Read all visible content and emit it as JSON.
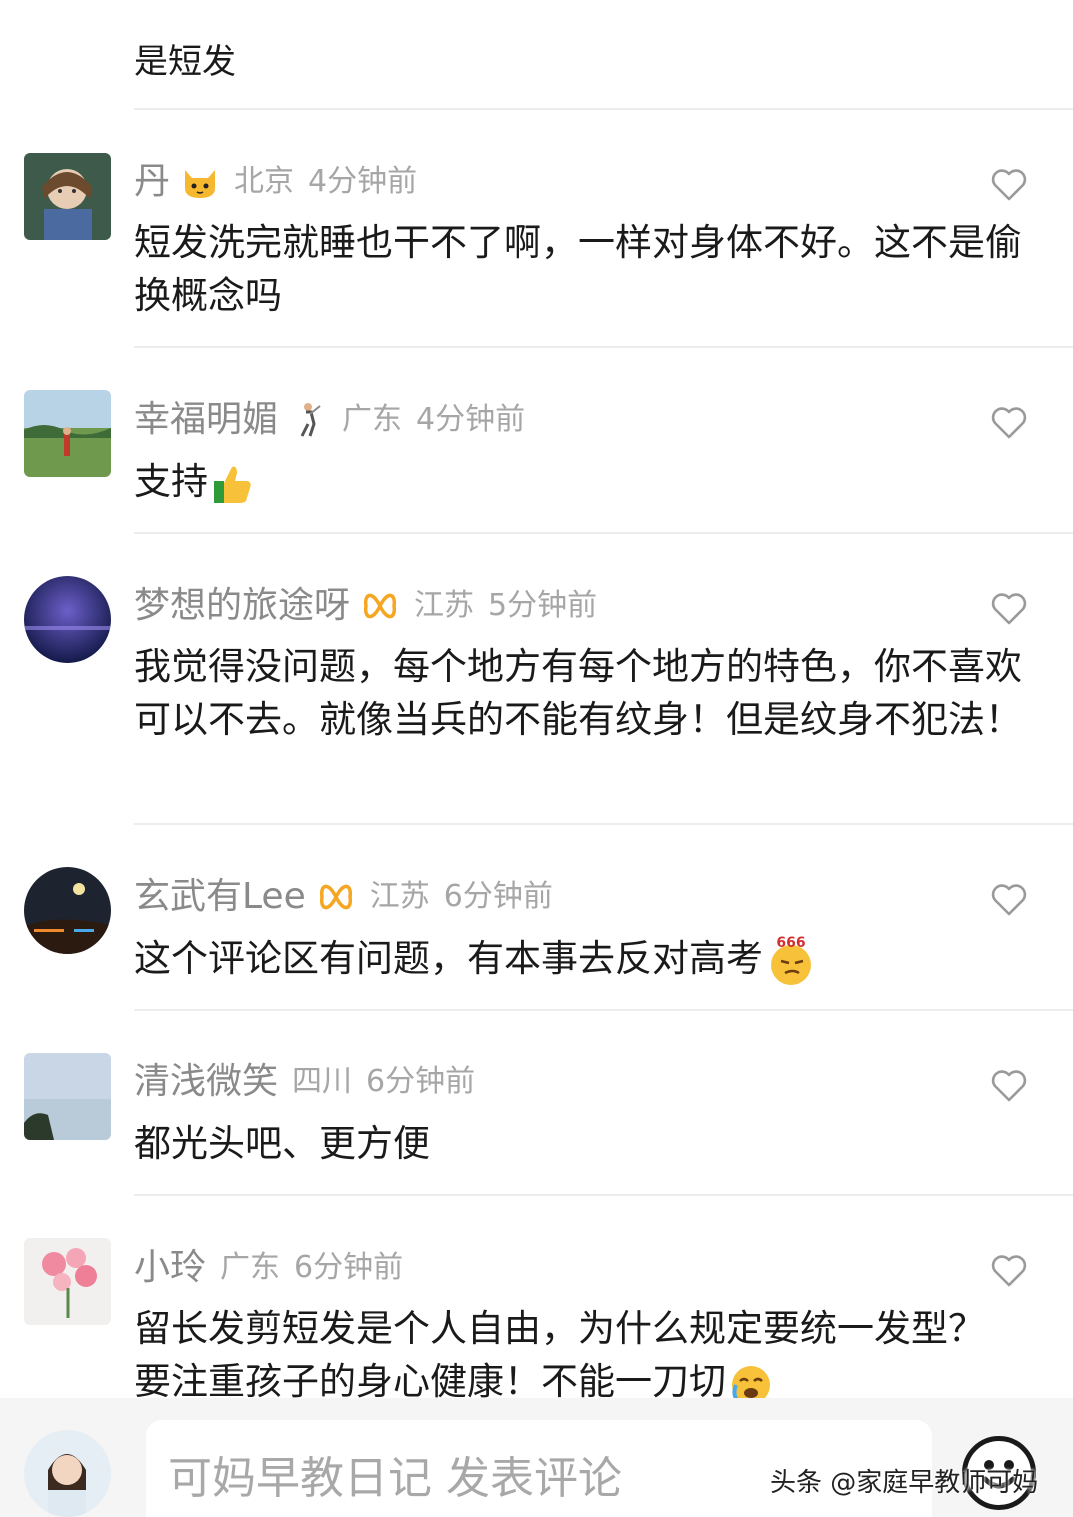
{
  "top_text": "是短发",
  "comments": [
    {
      "name": "丹",
      "badge": "cat-emoji-icon",
      "location": "北京",
      "time": "4分钟前",
      "text": "短发洗完就睡也干不了啊，一样对身体不好。这不是偷换概念吗"
    },
    {
      "name": "幸福明媚",
      "badge": "golfer-emoji-icon",
      "location": "广东",
      "time": "4分钟前",
      "text": "支持"
    },
    {
      "name": "梦想的旅途呀",
      "badge": "ribbon-badge-icon",
      "location": "江苏",
      "time": "5分钟前",
      "text": "我觉得没问题，每个地方有每个地方的特色，你不喜欢可以不去。就像当兵的不能有纹身！但是纹身不犯法！"
    },
    {
      "name": "玄武有Lee",
      "badge": "ribbon-badge-icon",
      "location": "江苏",
      "time": "6分钟前",
      "text": "这个评论区有问题，有本事去反对高考"
    },
    {
      "name": "清浅微笑",
      "badge": "",
      "location": "四川",
      "time": "6分钟前",
      "text": "都光头吧、更方便"
    },
    {
      "name": "小玲",
      "badge": "",
      "location": "广东",
      "time": "6分钟前",
      "text": "留长发剪短发是个人自由，为什么规定要统一发型？要注重孩子的身心健康！不能一刀切"
    }
  ],
  "emoji_666_text": "666",
  "bottom_bar": {
    "input_placeholder": "可妈早教日记 发表评论"
  },
  "watermark": "头条 @家庭早教师可妈",
  "colors": {
    "name": "#8a8a8a",
    "meta": "#a6a6a6",
    "divider": "#ededed",
    "badge": "#f5a623"
  }
}
